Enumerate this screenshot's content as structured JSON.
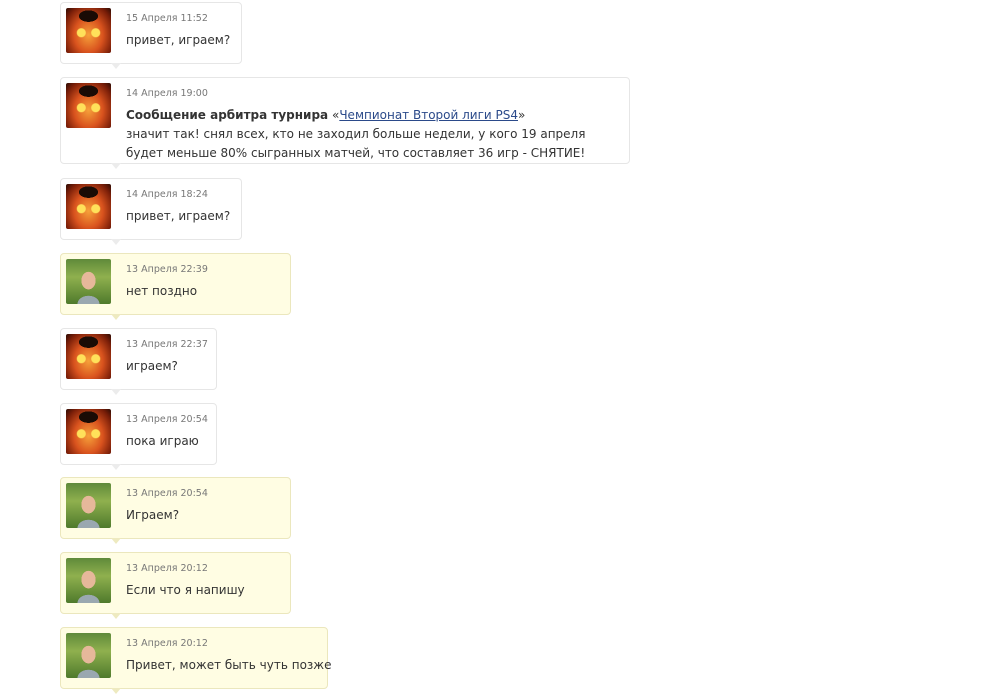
{
  "messages": [
    {
      "side": "me",
      "date": "15 Апреля 11:52",
      "text": "привет, играем?"
    },
    {
      "side": "me",
      "date": "14 Апреля 19:00",
      "arbiter": {
        "prefix": "Сообщение арбитра турнира",
        "quote_open": "«",
        "link": "Чемпионат Второй лиги PS4",
        "quote_close": "»",
        "line1": "значит так! снял всех, кто не заходил больше недели, у кого 19 апреля",
        "line2": "будет меньше 80% сыгранных матчей, что составляет 36 игр - СНЯТИЕ!"
      }
    },
    {
      "side": "me",
      "date": "14 Апреля 18:24",
      "text": "привет, играем?"
    },
    {
      "side": "friend",
      "date": "13 Апреля 22:39",
      "text": "нет поздно"
    },
    {
      "side": "me",
      "date": "13 Апреля 22:37",
      "text": "играем?"
    },
    {
      "side": "me",
      "date": "13 Апреля 20:54",
      "text": "пока играю"
    },
    {
      "side": "friend",
      "date": "13 Апреля 20:54",
      "text": "Играем?"
    },
    {
      "side": "friend",
      "date": "13 Апреля 20:12",
      "text": "Если что я напишу"
    },
    {
      "side": "friend",
      "date": "13 Апреля 20:12",
      "text": "Привет, может быть чуть позже"
    }
  ],
  "colors": {
    "friend_bg": "#fffde3",
    "link": "#2b4a8a"
  },
  "icons": {
    "me_avatar": "cat-avatar-icon",
    "friend_avatar": "man-avatar-icon"
  }
}
